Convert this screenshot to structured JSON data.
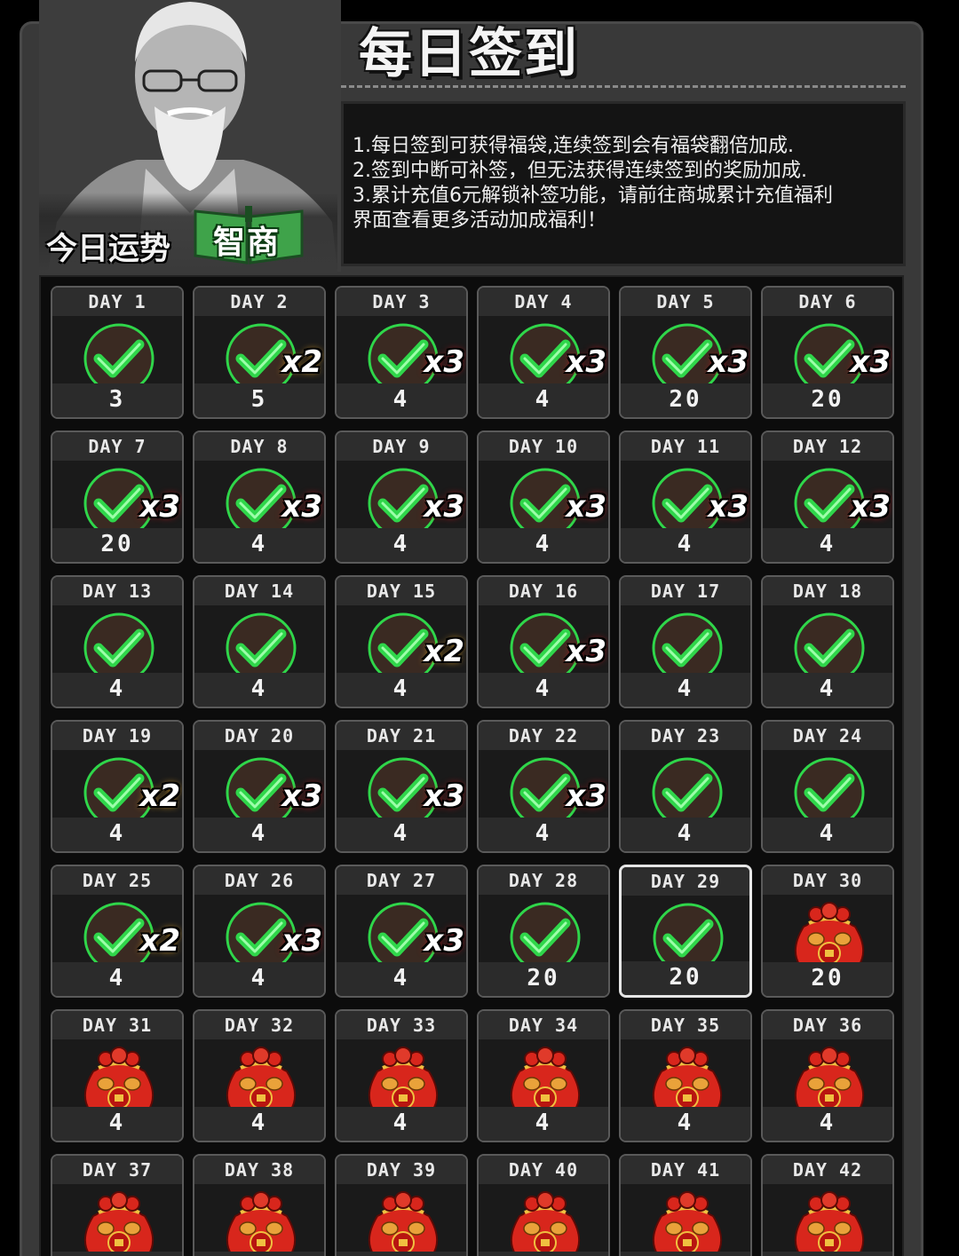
{
  "header": {
    "title": "每日签到",
    "fortune_label": "今日运势",
    "fortune_value": "智商"
  },
  "rules": [
    "1.每日签到可获得福袋,连续签到会有福袋翻倍加成.",
    "2.签到中断可补签，但无法获得连续签到的奖励加成.",
    "3.累计充值6元解锁补签功能，请前往商城累计充值福利",
    "界面查看更多活动加成福利！"
  ],
  "colors": {
    "check_green": "#2fd64a",
    "bag_red": "#d8261c",
    "bonus_x2": "#e0a020",
    "bonus_x3": "#c0141a"
  },
  "days": [
    {
      "label": "DAY 1",
      "amount": "3",
      "signed": true,
      "bonus": ""
    },
    {
      "label": "DAY 2",
      "amount": "5",
      "signed": true,
      "bonus": "x2"
    },
    {
      "label": "DAY 3",
      "amount": "4",
      "signed": true,
      "bonus": "x3"
    },
    {
      "label": "DAY 4",
      "amount": "4",
      "signed": true,
      "bonus": "x3"
    },
    {
      "label": "DAY 5",
      "amount": "20",
      "signed": true,
      "bonus": "x3"
    },
    {
      "label": "DAY 6",
      "amount": "20",
      "signed": true,
      "bonus": "x3"
    },
    {
      "label": "DAY 7",
      "amount": "20",
      "signed": true,
      "bonus": "x3"
    },
    {
      "label": "DAY 8",
      "amount": "4",
      "signed": true,
      "bonus": "x3"
    },
    {
      "label": "DAY 9",
      "amount": "4",
      "signed": true,
      "bonus": "x3"
    },
    {
      "label": "DAY 10",
      "amount": "4",
      "signed": true,
      "bonus": "x3"
    },
    {
      "label": "DAY 11",
      "amount": "4",
      "signed": true,
      "bonus": "x3"
    },
    {
      "label": "DAY 12",
      "amount": "4",
      "signed": true,
      "bonus": "x3"
    },
    {
      "label": "DAY 13",
      "amount": "4",
      "signed": true,
      "bonus": ""
    },
    {
      "label": "DAY 14",
      "amount": "4",
      "signed": true,
      "bonus": ""
    },
    {
      "label": "DAY 15",
      "amount": "4",
      "signed": true,
      "bonus": "x2"
    },
    {
      "label": "DAY 16",
      "amount": "4",
      "signed": true,
      "bonus": "x3"
    },
    {
      "label": "DAY 17",
      "amount": "4",
      "signed": true,
      "bonus": ""
    },
    {
      "label": "DAY 18",
      "amount": "4",
      "signed": true,
      "bonus": ""
    },
    {
      "label": "DAY 19",
      "amount": "4",
      "signed": true,
      "bonus": "x2"
    },
    {
      "label": "DAY 20",
      "amount": "4",
      "signed": true,
      "bonus": "x3"
    },
    {
      "label": "DAY 21",
      "amount": "4",
      "signed": true,
      "bonus": "x3"
    },
    {
      "label": "DAY 22",
      "amount": "4",
      "signed": true,
      "bonus": "x3"
    },
    {
      "label": "DAY 23",
      "amount": "4",
      "signed": true,
      "bonus": ""
    },
    {
      "label": "DAY 24",
      "amount": "4",
      "signed": true,
      "bonus": ""
    },
    {
      "label": "DAY 25",
      "amount": "4",
      "signed": true,
      "bonus": "x2"
    },
    {
      "label": "DAY 26",
      "amount": "4",
      "signed": true,
      "bonus": "x3"
    },
    {
      "label": "DAY 27",
      "amount": "4",
      "signed": true,
      "bonus": "x3"
    },
    {
      "label": "DAY 28",
      "amount": "20",
      "signed": true,
      "bonus": ""
    },
    {
      "label": "DAY 29",
      "amount": "20",
      "signed": true,
      "bonus": "",
      "today": true
    },
    {
      "label": "DAY 30",
      "amount": "20",
      "signed": false,
      "bonus": ""
    },
    {
      "label": "DAY 31",
      "amount": "4",
      "signed": false,
      "bonus": ""
    },
    {
      "label": "DAY 32",
      "amount": "4",
      "signed": false,
      "bonus": ""
    },
    {
      "label": "DAY 33",
      "amount": "4",
      "signed": false,
      "bonus": ""
    },
    {
      "label": "DAY 34",
      "amount": "4",
      "signed": false,
      "bonus": ""
    },
    {
      "label": "DAY 35",
      "amount": "4",
      "signed": false,
      "bonus": ""
    },
    {
      "label": "DAY 36",
      "amount": "4",
      "signed": false,
      "bonus": ""
    },
    {
      "label": "DAY 37",
      "amount": "",
      "signed": false,
      "bonus": ""
    },
    {
      "label": "DAY 38",
      "amount": "",
      "signed": false,
      "bonus": ""
    },
    {
      "label": "DAY 39",
      "amount": "",
      "signed": false,
      "bonus": ""
    },
    {
      "label": "DAY 40",
      "amount": "",
      "signed": false,
      "bonus": ""
    },
    {
      "label": "DAY 41",
      "amount": "",
      "signed": false,
      "bonus": ""
    },
    {
      "label": "DAY 42",
      "amount": "",
      "signed": false,
      "bonus": ""
    }
  ]
}
